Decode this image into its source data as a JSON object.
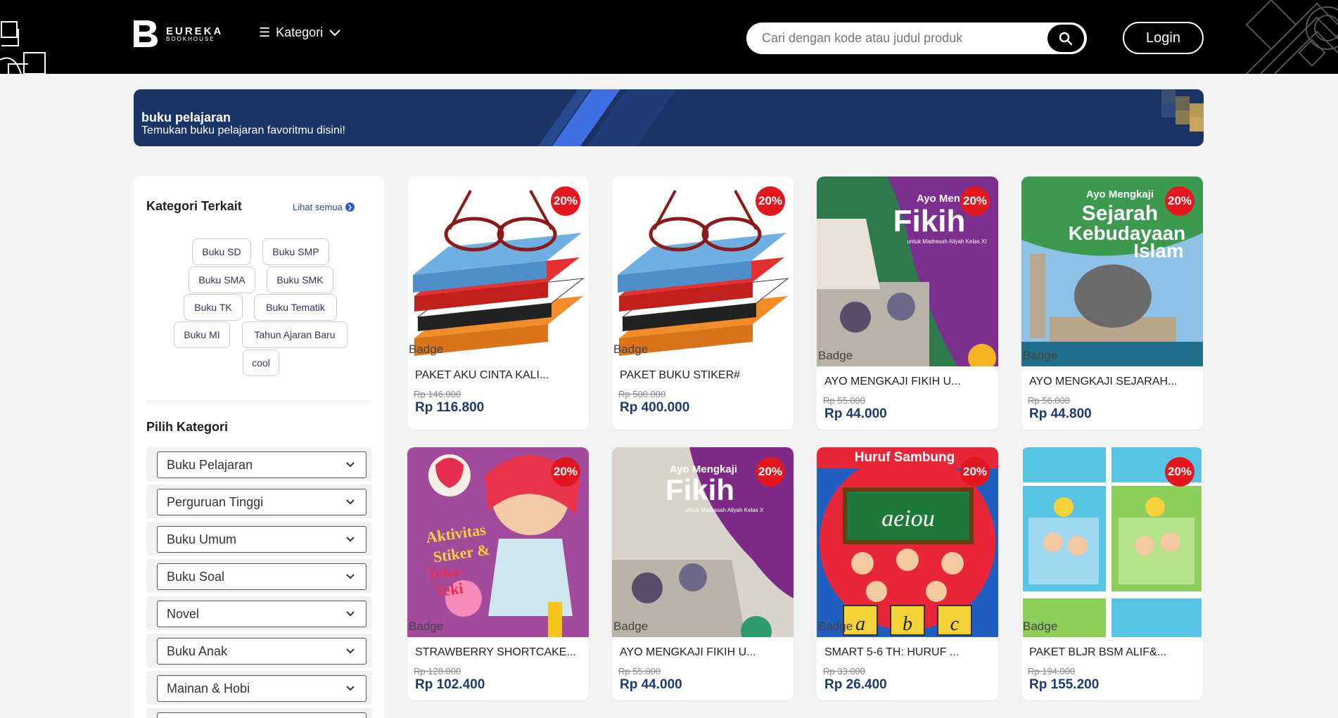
{
  "header": {
    "logo_name": "EUREKA",
    "logo_sub": "BOOKHOUSE",
    "kategori_label": "Kategori",
    "search_placeholder": "Cari dengan kode atau judul produk",
    "login_label": "Login"
  },
  "banner": {
    "title": "buku pelajaran",
    "subtitle": "Temukan buku pelajaran favoritmu disini!"
  },
  "sidebar": {
    "related_title": "Kategori Terkait",
    "see_all_label": "Lihat semua",
    "chips": [
      "Buku SD",
      "Buku SMP",
      "Buku SMA",
      "Buku SMK",
      "Buku TK",
      "Buku Tematik",
      "Buku MI",
      "Tahun Ajaran Baru",
      "cool"
    ],
    "pick_title": "Pilih Kategori",
    "categories": [
      "Buku Pelajaran",
      "Perguruan Tinggi",
      "Buku Umum",
      "Buku Soal",
      "Novel",
      "Buku Anak",
      "Mainan & Hobi"
    ]
  },
  "products": [
    {
      "name": "PAKET AKU CINTA KALI...",
      "old_price": "Rp 146.000",
      "price": "Rp 116.800",
      "discount": "20%",
      "badge_alt": "Badge",
      "cover": "books-glasses"
    },
    {
      "name": "PAKET BUKU STIKER#",
      "old_price": "Rp 500.000",
      "price": "Rp 400.000",
      "discount": "20%",
      "badge_alt": "Badge",
      "cover": "books-glasses"
    },
    {
      "name": "AYO MENGKAJI FIKIH U...",
      "old_price": "Rp 55.000",
      "price": "Rp 44.000",
      "discount": "20%",
      "badge_alt": "Badge",
      "cover": "fikih-xi",
      "cover_text": [
        "Ayo Mengkaji",
        "Fikih",
        "untuk Madrasah Aliyah Kelas XI"
      ]
    },
    {
      "name": "AYO MENGKAJI SEJARAH...",
      "old_price": "Rp 56.000",
      "price": "Rp 44.800",
      "discount": "20%",
      "badge_alt": "Badge",
      "cover": "sejarah",
      "cover_text": [
        "Ayo Mengkaji",
        "Sejarah",
        "Kebudayaan",
        "Islam"
      ]
    },
    {
      "name": "STRAWBERRY SHORTCAKE...",
      "old_price": "Rp 128.000",
      "price": "Rp 102.400",
      "discount": "20%",
      "badge_alt": "Badge",
      "cover": "strawberry",
      "cover_text": [
        "Aktivitas",
        "Stiker &",
        "Teka-",
        "Teki"
      ]
    },
    {
      "name": "AYO MENGKAJI FIKIH U...",
      "old_price": "Rp 55.000",
      "price": "Rp 44.000",
      "discount": "20%",
      "badge_alt": "Badge",
      "cover": "fikih-x",
      "cover_text": [
        "Ayo Mengkaji",
        "Fikih",
        "untuk Madrasah Aliyah Kelas X"
      ]
    },
    {
      "name": "SMART 5-6 TH: HURUF ...",
      "old_price": "Rp 33.000",
      "price": "Rp 26.400",
      "discount": "20%",
      "badge_alt": "Badge",
      "cover": "huruf",
      "cover_text": [
        "Huruf Sambung",
        "aeiou",
        "a",
        "b",
        "c"
      ]
    },
    {
      "name": "PAKET BLJR BSM ALIF&...",
      "old_price": "Rp 194.000",
      "price": "Rp 155.200",
      "discount": "20%",
      "badge_alt": "Badge",
      "cover": "paket-bsm"
    }
  ]
}
